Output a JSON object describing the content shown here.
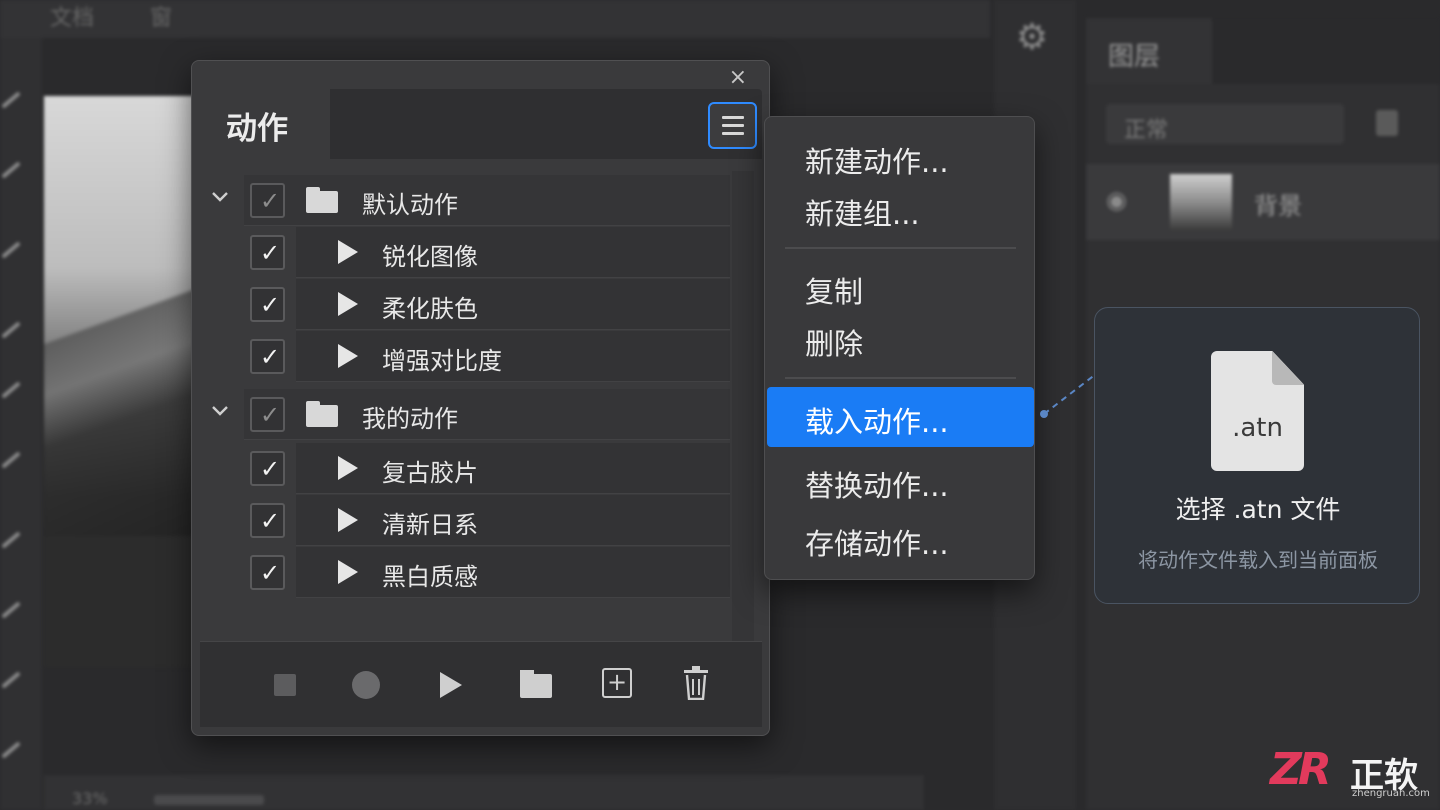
{
  "background": {
    "top_menu": [
      "文档",
      "窗"
    ],
    "right_panel": {
      "tab": "图层",
      "blend_mode": "正常",
      "layer_name": "背景"
    },
    "status_zoom": "33%"
  },
  "actions_panel": {
    "close_glyph": "×",
    "tab_label": "动作",
    "groups": [
      {
        "label": "默认动作",
        "items": [
          "锐化图像",
          "柔化肤色",
          "增强对比度"
        ]
      },
      {
        "label": "我的动作",
        "items": [
          "复古胶片",
          "清新日系",
          "黑白质感"
        ]
      }
    ],
    "check_glyph": "✓",
    "new_action_glyph": "+"
  },
  "flyout_menu": {
    "items": [
      "新建动作...",
      "新建组...",
      "复制",
      "删除",
      "载入动作...",
      "替换动作...",
      "存储动作..."
    ],
    "highlighted": "载入动作..."
  },
  "callout": {
    "file_ext": ".atn",
    "title": "选择 .atn 文件",
    "description": "将动作文件载入到当前面板"
  },
  "watermark": {
    "logo": "ZR",
    "name": "正软",
    "url": "zhengruan.com"
  },
  "colors": {
    "accent": "#1a7cf5",
    "panel_bg": "#3a3a3c",
    "watermark_red": "#e23a5c"
  }
}
